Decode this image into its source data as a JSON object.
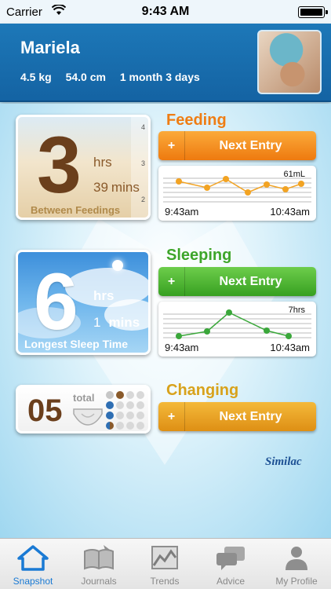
{
  "status_bar": {
    "carrier": "Carrier",
    "time": "9:43 AM"
  },
  "profile": {
    "name": "Mariela",
    "weight": "4.5 kg",
    "length": "54.0 cm",
    "age": "1 month 3 days"
  },
  "feeding": {
    "title": "Feeding",
    "big_number": "3",
    "hrs_label": "hrs",
    "mins_value": "39",
    "mins_label": "mins",
    "caption": "Between Feedings",
    "button_plus": "+",
    "button_label": "Next Entry",
    "graph": {
      "value_label": "61mL",
      "from": "9:43am",
      "to": "10:43am"
    }
  },
  "sleeping": {
    "title": "Sleeping",
    "big_number": "6",
    "hrs_label": "hrs",
    "mins_value": "1",
    "mins_label": "mins",
    "caption": "Longest Sleep Time",
    "button_plus": "+",
    "button_label": "Next Entry",
    "graph": {
      "value_label": "7hrs",
      "from": "9:43am",
      "to": "10:43am"
    }
  },
  "changing": {
    "title": "Changing",
    "count": "05",
    "total_label": "total",
    "button_plus": "+",
    "button_label": "Next Entry"
  },
  "brand": "Similac",
  "tabs": [
    {
      "label": "Snapshot",
      "icon": "home-icon",
      "active": true
    },
    {
      "label": "Journals",
      "icon": "journal-icon",
      "active": false
    },
    {
      "label": "Trends",
      "icon": "trends-icon",
      "active": false
    },
    {
      "label": "Advice",
      "icon": "chat-bubbles-icon",
      "active": false
    },
    {
      "label": "My Profile",
      "icon": "person-icon",
      "active": false
    }
  ],
  "colors": {
    "header_blue": "#1668a8",
    "feeding_orange": "#ef7d14",
    "sleeping_green": "#3ea52a",
    "changing_gold": "#d8a21b",
    "tab_active": "#1a7ad4"
  }
}
